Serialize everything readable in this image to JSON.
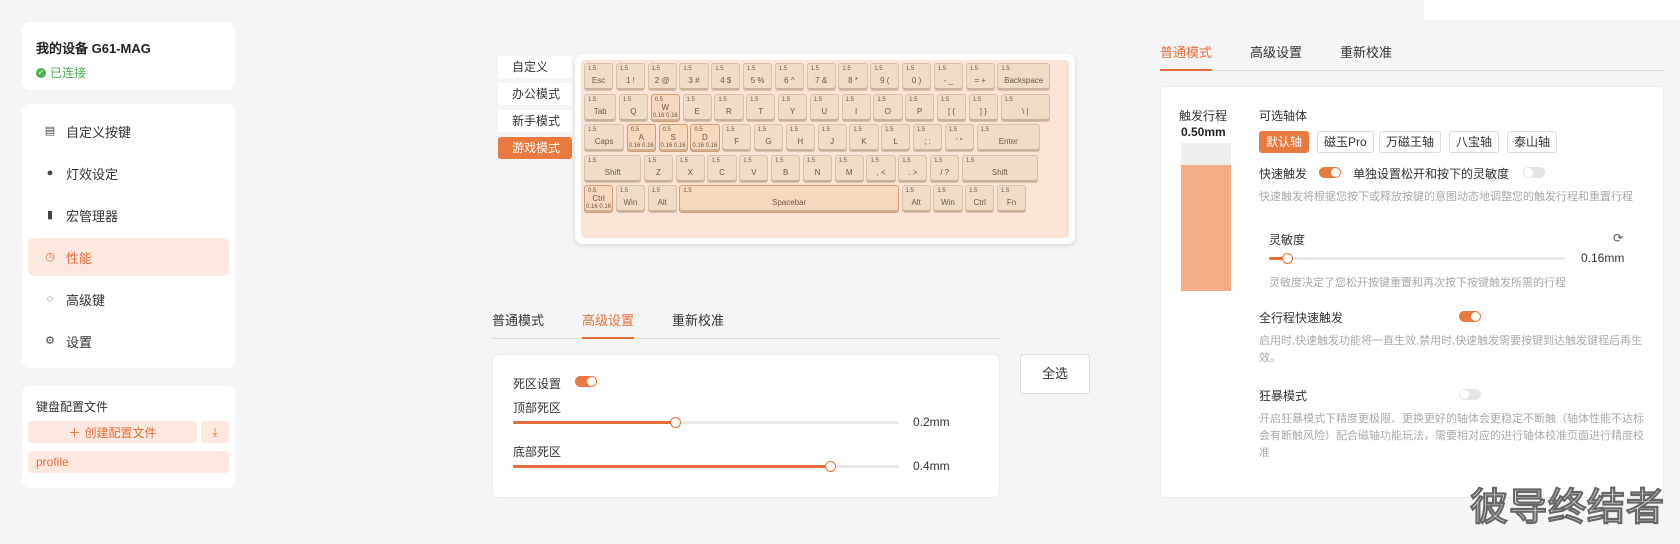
{
  "device": {
    "name": "我的设备 G61-MAG",
    "status": "已连接"
  },
  "menu": [
    {
      "label": "自定义按键",
      "icon": "keyboard-icon",
      "glyph": "▤",
      "active": false
    },
    {
      "label": "灯效设定",
      "icon": "bulb-icon",
      "glyph": "●",
      "active": false
    },
    {
      "label": "宏管理器",
      "icon": "macro-icon",
      "glyph": "▮",
      "active": false
    },
    {
      "label": "性能",
      "icon": "gauge-icon",
      "glyph": "◷",
      "active": true
    },
    {
      "label": "高级键",
      "icon": "chip-icon",
      "glyph": "◌",
      "active": false
    },
    {
      "label": "设置",
      "icon": "gear-icon",
      "glyph": "⚙",
      "active": false
    }
  ],
  "profiles": {
    "title": "键盘配置文件",
    "create_label": "创建配置文件",
    "items": [
      "profile"
    ]
  },
  "modes": [
    {
      "label": "自定义",
      "active": false
    },
    {
      "label": "办公模式",
      "active": false
    },
    {
      "label": "新手模式",
      "active": false
    },
    {
      "label": "游戏模式",
      "active": true
    }
  ],
  "keyboard": {
    "rows": [
      [
        [
          "1.5",
          "Esc",
          ""
        ],
        [
          "1.5",
          "1 !",
          ""
        ],
        [
          "1.5",
          "2 @",
          ""
        ],
        [
          "1.5",
          "3 #",
          ""
        ],
        [
          "1.5",
          "4 $",
          ""
        ],
        [
          "1.5",
          "5 %",
          ""
        ],
        [
          "1.5",
          "6 ^",
          ""
        ],
        [
          "1.5",
          "7 &",
          ""
        ],
        [
          "1.5",
          "8 *",
          ""
        ],
        [
          "1.5",
          "9 (",
          ""
        ],
        [
          "1.5",
          "0 )",
          ""
        ],
        [
          "1.5",
          "- _",
          ""
        ],
        [
          "1.5",
          "= +",
          ""
        ],
        [
          "1.5",
          "Backspace",
          ""
        ]
      ],
      [
        [
          "1.5",
          "Tab",
          ""
        ],
        [
          "1.5",
          "Q",
          ""
        ],
        [
          "0.5",
          "W",
          "0.16 0.16"
        ],
        [
          "1.5",
          "E",
          ""
        ],
        [
          "1.5",
          "R",
          ""
        ],
        [
          "1.5",
          "T",
          ""
        ],
        [
          "1.5",
          "Y",
          ""
        ],
        [
          "1.5",
          "U",
          ""
        ],
        [
          "1.5",
          "I",
          ""
        ],
        [
          "1.5",
          "O",
          ""
        ],
        [
          "1.5",
          "P",
          ""
        ],
        [
          "1.5",
          "[ {",
          ""
        ],
        [
          "1.5",
          "] }",
          ""
        ],
        [
          "1.5",
          "\\ |",
          ""
        ]
      ],
      [
        [
          "1.5",
          "Caps",
          ""
        ],
        [
          "0.5",
          "A",
          "0.16 0.16"
        ],
        [
          "0.5",
          "S",
          "0.16 0.16"
        ],
        [
          "0.5",
          "D",
          "0.16 0.16"
        ],
        [
          "1.5",
          "F",
          ""
        ],
        [
          "1.5",
          "G",
          ""
        ],
        [
          "1.5",
          "H",
          ""
        ],
        [
          "1.5",
          "J",
          ""
        ],
        [
          "1.5",
          "K",
          ""
        ],
        [
          "1.5",
          "L",
          ""
        ],
        [
          "1.5",
          "; :",
          ""
        ],
        [
          "1.5",
          "' \"",
          ""
        ],
        [
          "1.5",
          "Enter",
          ""
        ]
      ],
      [
        [
          "1.5",
          "Shift",
          ""
        ],
        [
          "1.5",
          "Z",
          ""
        ],
        [
          "1.5",
          "X",
          ""
        ],
        [
          "1.5",
          "C",
          ""
        ],
        [
          "1.5",
          "V",
          ""
        ],
        [
          "1.5",
          "B",
          ""
        ],
        [
          "1.5",
          "N",
          ""
        ],
        [
          "1.5",
          "M",
          ""
        ],
        [
          "1.5",
          ", <",
          ""
        ],
        [
          "1.5",
          ". >",
          ""
        ],
        [
          "1.5",
          "/ ?",
          ""
        ],
        [
          "1.5",
          "Shift",
          ""
        ]
      ],
      [
        [
          "0.5",
          "Ctrl",
          "0.16 0.16"
        ],
        [
          "1.5",
          "Win",
          ""
        ],
        [
          "1.5",
          "Alt",
          ""
        ],
        [
          "1.5",
          "Spacebar",
          ""
        ],
        [
          "1.5",
          "Alt",
          ""
        ],
        [
          "1.5",
          "Win",
          ""
        ],
        [
          "1.5",
          "Ctrl",
          ""
        ],
        [
          "1.5",
          "Fn",
          ""
        ]
      ]
    ]
  },
  "mid_tabs": [
    {
      "label": "普通模式",
      "active": false
    },
    {
      "label": "高级设置",
      "active": true
    },
    {
      "label": "重新校准",
      "active": false
    }
  ],
  "deadzone": {
    "title": "死区设置",
    "enabled": true,
    "top": {
      "label": "顶部死区",
      "value": "0.2mm",
      "fraction": 0.42
    },
    "bottom": {
      "label": "底部死区",
      "value": "0.4mm",
      "fraction": 0.82
    }
  },
  "select_all": "全选",
  "right_tabs": [
    {
      "label": "普通模式",
      "active": true
    },
    {
      "label": "高级设置",
      "active": false
    },
    {
      "label": "重新校准",
      "active": false
    }
  ],
  "trigger": {
    "label": "触发行程",
    "value": "0.50mm",
    "fill_fraction": 0.85
  },
  "switches": {
    "title": "可选轴体",
    "options": [
      {
        "label": "默认轴",
        "active": true
      },
      {
        "label": "磁玉Pro",
        "active": false
      },
      {
        "label": "万磁王轴",
        "active": false
      },
      {
        "label": "八宝轴",
        "active": false
      },
      {
        "label": "泰山轴",
        "active": false
      }
    ]
  },
  "rapid": {
    "label": "快速触发",
    "enabled": true,
    "separate_label": "单独设置松开和按下的灵敏度",
    "separate_enabled": false,
    "desc": "快速触发将根据您按下或释放按键的意图动态地调整您的触发行程和重置行程",
    "sensitivity_label": "灵敏度",
    "sensitivity_value": "0.16mm",
    "sensitivity_fraction": 0.06,
    "sensitivity_desc": "灵敏度决定了您松开按键重置和再次按下按键触发所需的行程"
  },
  "full_travel": {
    "label": "全行程快速触发",
    "enabled": true,
    "desc": "启用时,快速触发功能将一直生效,禁用时,快速触发需要按键到达触发键程后再生效。"
  },
  "berserk": {
    "label": "狂暴模式",
    "enabled": false,
    "desc": "开启狂暴模式下精度更极限、更换更好的轴体会更稳定不断触（轴体性能不达标会有断触风险）配合磁轴功能玩法，需要相对应的进行轴体校准页面进行精度校准"
  },
  "watermark": "彼导终结者",
  "colors": {
    "accent": "#e46f3a",
    "active_bg": "#fde8e0",
    "status_green": "#4caf50"
  }
}
